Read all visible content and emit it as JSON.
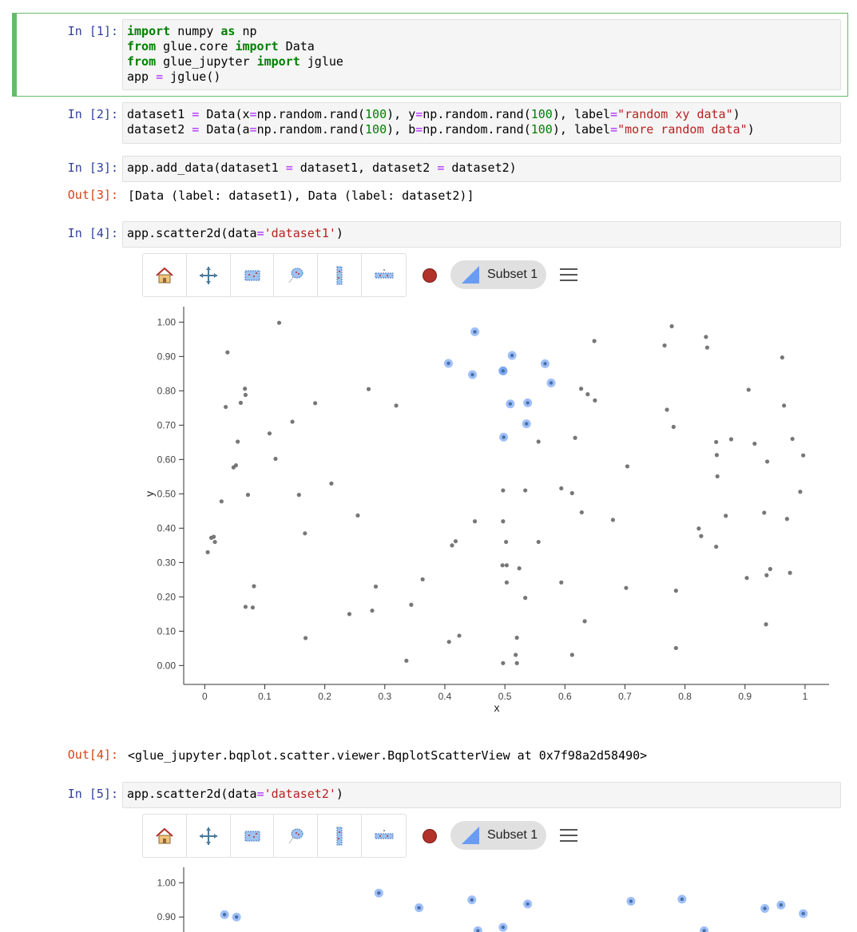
{
  "cells": {
    "c1": {
      "prompt": "In [1]:"
    },
    "c2": {
      "prompt": "In [2]:"
    },
    "c3": {
      "prompt": "In [3]:",
      "out_prompt": "Out[3]:",
      "output": "[Data (label: dataset1), Data (label: dataset2)]"
    },
    "c4": {
      "prompt": "In [4]:",
      "out_prompt": "Out[4]:",
      "output": "<glue_jupyter.bqplot.scatter.viewer.BqplotScatterView at 0x7f98a2d58490>"
    },
    "c5": {
      "prompt": "In [5]:"
    }
  },
  "code": {
    "c1": [
      [
        [
          "kw",
          "import"
        ],
        [
          "t",
          " numpy "
        ],
        [
          "kw",
          "as"
        ],
        [
          "t",
          " np"
        ]
      ],
      [
        [
          "kw",
          "from"
        ],
        [
          "t",
          " glue.core "
        ],
        [
          "kw",
          "import"
        ],
        [
          "t",
          " Data"
        ]
      ],
      [
        [
          "kw",
          "from"
        ],
        [
          "t",
          " glue_jupyter "
        ],
        [
          "kw",
          "import"
        ],
        [
          "t",
          " jglue"
        ]
      ],
      [
        [
          "t",
          "app "
        ],
        [
          "op",
          "="
        ],
        [
          "t",
          " jglue()"
        ]
      ]
    ],
    "c2": [
      [
        [
          "t",
          "dataset1 "
        ],
        [
          "op",
          "="
        ],
        [
          "t",
          " Data(x"
        ],
        [
          "op",
          "="
        ],
        [
          "t",
          "np.random.rand("
        ],
        [
          "num",
          "100"
        ],
        [
          "t",
          "), y"
        ],
        [
          "op",
          "="
        ],
        [
          "t",
          "np.random.rand("
        ],
        [
          "num",
          "100"
        ],
        [
          "t",
          "), label"
        ],
        [
          "op",
          "="
        ],
        [
          "str",
          "\"random xy data\""
        ],
        [
          "t",
          ")"
        ]
      ],
      [
        [
          "t",
          "dataset2 "
        ],
        [
          "op",
          "="
        ],
        [
          "t",
          " Data(a"
        ],
        [
          "op",
          "="
        ],
        [
          "t",
          "np.random.rand("
        ],
        [
          "num",
          "100"
        ],
        [
          "t",
          "), b"
        ],
        [
          "op",
          "="
        ],
        [
          "t",
          "np.random.rand("
        ],
        [
          "num",
          "100"
        ],
        [
          "t",
          "), label"
        ],
        [
          "op",
          "="
        ],
        [
          "str",
          "\"more random data\""
        ],
        [
          "t",
          ")"
        ]
      ]
    ],
    "c3": [
      [
        [
          "t",
          "app.add_data(dataset1 "
        ],
        [
          "op",
          "="
        ],
        [
          "t",
          " dataset1, dataset2 "
        ],
        [
          "op",
          "="
        ],
        [
          "t",
          " dataset2)"
        ]
      ]
    ],
    "c4": [
      [
        [
          "t",
          "app.scatter2d(data"
        ],
        [
          "op",
          "="
        ],
        [
          "str",
          "'dataset1'"
        ],
        [
          "t",
          ")"
        ]
      ]
    ],
    "c5": [
      [
        [
          "t",
          "app.scatter2d(data"
        ],
        [
          "op",
          "="
        ],
        [
          "str",
          "'dataset2'"
        ],
        [
          "t",
          ")"
        ]
      ]
    ]
  },
  "viewer": {
    "tools": [
      "home-icon",
      "pan-icon",
      "rectangle-select-icon",
      "lasso-select-icon",
      "x-range-select-icon",
      "y-range-select-icon"
    ],
    "subset_label": "Subset 1",
    "subset_color": "#b3312b",
    "highlight_color": "#6a9cf5"
  },
  "chart_data": [
    {
      "type": "scatter",
      "title": "",
      "xlabel": "x",
      "ylabel": "y",
      "xlim": [
        -0.035,
        1.04
      ],
      "ylim": [
        -0.055,
        1.045
      ],
      "xticks": [
        "0",
        "0.1",
        "0.2",
        "0.3",
        "0.4",
        "0.5",
        "0.6",
        "0.7",
        "0.8",
        "0.9",
        "1"
      ],
      "yticks": [
        "0.00",
        "0.10",
        "0.20",
        "0.30",
        "0.40",
        "0.50",
        "0.60",
        "0.70",
        "0.80",
        "0.90",
        "1.00"
      ],
      "series": [
        {
          "x": [
            0.005,
            0.015,
            0.017,
            0.028,
            0.035,
            0.038,
            0.048,
            0.052,
            0.055,
            0.06,
            0.067,
            0.068,
            0.068,
            0.072,
            0.08,
            0.082,
            0.108,
            0.118,
            0.124,
            0.146,
            0.157,
            0.167,
            0.168,
            0.184,
            0.211,
            0.241,
            0.255,
            0.273,
            0.279,
            0.285,
            0.319,
            0.336,
            0.344,
            0.363,
            0.407,
            0.412,
            0.418,
            0.424,
            0.45,
            0.496,
            0.497,
            0.497,
            0.502,
            0.503,
            0.518,
            0.52,
            0.524,
            0.534,
            0.556,
            0.594,
            0.612,
            0.617,
            0.627,
            0.628,
            0.633,
            0.638,
            0.649,
            0.65,
            0.68,
            0.702,
            0.704,
            0.766,
            0.77,
            0.778,
            0.781,
            0.785,
            0.785,
            0.823,
            0.827,
            0.835,
            0.837,
            0.852,
            0.852,
            0.853,
            0.854,
            0.868,
            0.877,
            0.903,
            0.906,
            0.916,
            0.932,
            0.935,
            0.936,
            0.937,
            0.942,
            0.962,
            0.965,
            0.97,
            0.975,
            0.979,
            0.992,
            0.997,
            0.011,
            0.497,
            0.503,
            0.52,
            0.534,
            0.556,
            0.594,
            0.612
          ],
          "y": [
            0.33,
            0.375,
            0.36,
            0.478,
            0.753,
            0.912,
            0.577,
            0.583,
            0.652,
            0.765,
            0.806,
            0.788,
            0.171,
            0.497,
            0.169,
            0.231,
            0.676,
            0.602,
            0.998,
            0.71,
            0.497,
            0.385,
            0.08,
            0.764,
            0.53,
            0.15,
            0.437,
            0.805,
            0.16,
            0.23,
            0.757,
            0.014,
            0.177,
            0.251,
            0.069,
            0.35,
            0.362,
            0.087,
            0.42,
            0.292,
            0.007,
            0.51,
            0.36,
            0.242,
            0.031,
            0.081,
            0.283,
            0.197,
            0.652,
            0.516,
            0.502,
            0.663,
            0.806,
            0.446,
            0.129,
            0.79,
            0.945,
            0.772,
            0.424,
            0.226,
            0.58,
            0.932,
            0.745,
            0.988,
            0.695,
            0.218,
            0.051,
            0.399,
            0.377,
            0.957,
            0.926,
            0.651,
            0.346,
            0.613,
            0.551,
            0.436,
            0.659,
            0.255,
            0.803,
            0.646,
            0.445,
            0.12,
            0.263,
            0.594,
            0.281,
            0.897,
            0.757,
            0.427,
            0.27,
            0.66,
            0.506,
            0.612,
            0.372,
            0.42,
            0.292,
            0.007,
            0.51,
            0.36,
            0.242,
            0.031
          ],
          "color": "#777777"
        },
        {
          "name": "Subset 1",
          "x": [
            0.406,
            0.45,
            0.446,
            0.497,
            0.512,
            0.497,
            0.567,
            0.577,
            0.509,
            0.538,
            0.498,
            0.536
          ],
          "y": [
            0.88,
            0.972,
            0.847,
            0.858,
            0.903,
            0.858,
            0.879,
            0.823,
            0.762,
            0.765,
            0.665,
            0.704
          ],
          "color": "#6a9cf5"
        }
      ]
    },
    {
      "type": "scatter",
      "title": "",
      "xlabel": "",
      "ylabel": "",
      "ylim": [
        0.84,
        1.045
      ],
      "yticks": [
        "0.90",
        "1.00"
      ],
      "series": [
        {
          "name": "Subset 1",
          "x": [
            0.033,
            0.053,
            0.29,
            0.357,
            0.445,
            0.497,
            0.538,
            0.71,
            0.795,
            0.832,
            0.933,
            0.96,
            0.997,
            0.455
          ],
          "y": [
            0.907,
            0.9,
            0.97,
            0.927,
            0.95,
            0.87,
            0.938,
            0.946,
            0.952,
            0.86,
            0.925,
            0.935,
            0.91,
            0.86
          ],
          "color": "#6a9cf5"
        }
      ]
    }
  ]
}
